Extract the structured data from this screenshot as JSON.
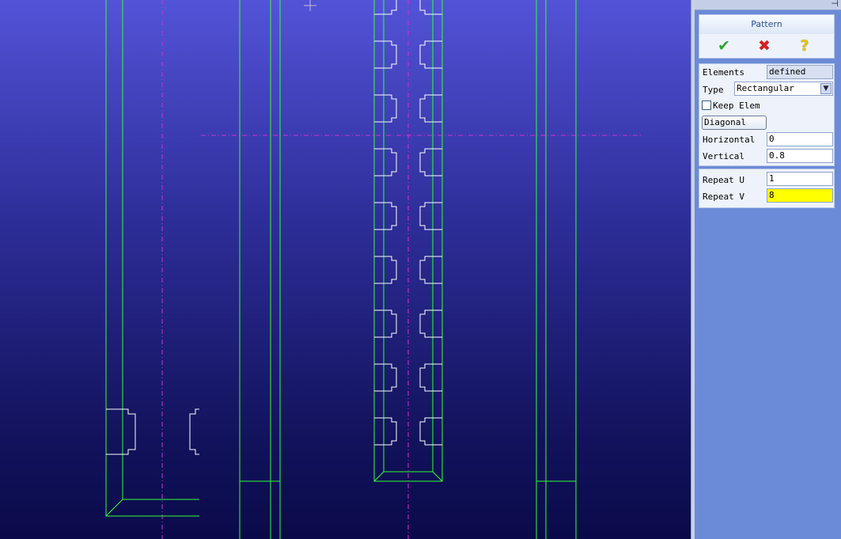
{
  "panel": {
    "title": "Pattern",
    "actions": {
      "ok_icon": "check-icon",
      "cancel_icon": "x-icon",
      "help_icon": "question-icon"
    },
    "fields": {
      "elements_label": "Elements",
      "elements_value": "defined",
      "type_label": "Type",
      "type_value": "Rectangular",
      "keep_elem_label": "Keep Elem",
      "keep_elem_checked": false,
      "diagonal_label": "Diagonal",
      "horizontal_label": "Horizontal",
      "horizontal_value": "0",
      "vertical_label": "Vertical",
      "vertical_value": "0.8",
      "repeat_u_label": "Repeat U",
      "repeat_u_value": "1",
      "repeat_v_label": "Repeat V",
      "repeat_v_value": "8"
    }
  },
  "colors": {
    "viewport_top": "#5353d8",
    "viewport_bottom": "#0a0a4a",
    "geometry_lines": "#33ff33",
    "profile_lines": "#ffffff",
    "axis_lines": "#d030d0",
    "highlight_field": "#ffff00",
    "panel_background": "#6b8bd8"
  },
  "icons": {
    "pin": "pin-icon",
    "cursor": "crosshair-cursor-icon"
  }
}
